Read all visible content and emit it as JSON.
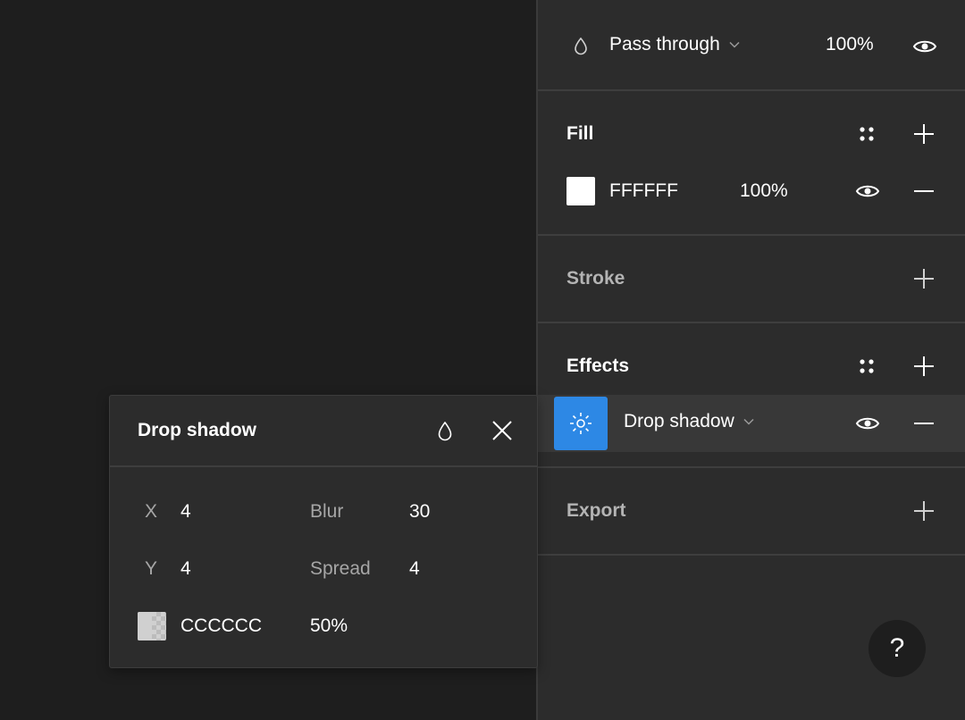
{
  "layer": {
    "blend_mode": "Pass through",
    "opacity": "100%"
  },
  "fill": {
    "title": "Fill",
    "color": "FFFFFF",
    "opacity": "100%"
  },
  "stroke": {
    "title": "Stroke"
  },
  "effects": {
    "title": "Effects",
    "item_label": "Drop shadow"
  },
  "export": {
    "title": "Export"
  },
  "help": {
    "label": "?"
  },
  "popover": {
    "title": "Drop shadow",
    "x_label": "X",
    "x_value": "4",
    "y_label": "Y",
    "y_value": "4",
    "blur_label": "Blur",
    "blur_value": "30",
    "spread_label": "Spread",
    "spread_value": "4",
    "color": "CCCCCC",
    "opacity": "50%"
  },
  "colors": {
    "canvas": "#1e1e1e",
    "panel": "#2c2c2c",
    "accent": "#2d88e5"
  }
}
